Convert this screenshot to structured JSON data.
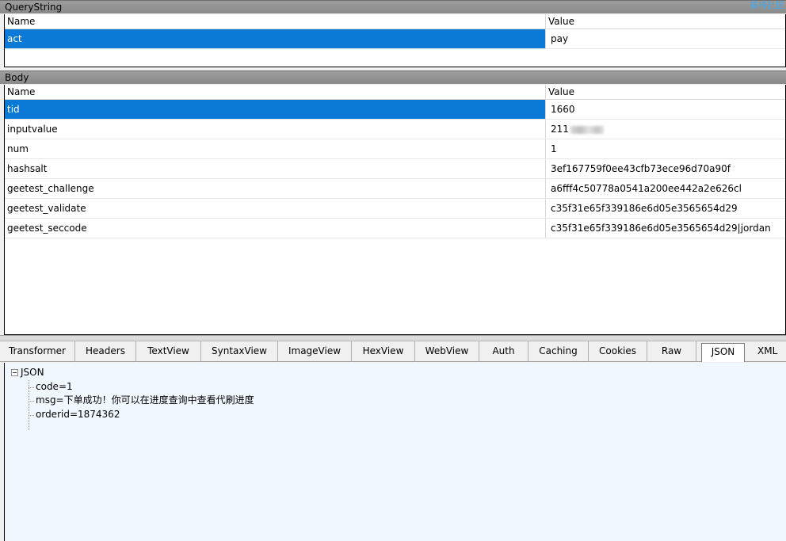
{
  "watermark": "搞棒社区",
  "querystring": {
    "section_title": "QueryString",
    "header": {
      "name": "Name",
      "value": "Value"
    },
    "rows": [
      {
        "name": "act",
        "value": "pay",
        "selected": true
      }
    ]
  },
  "body": {
    "section_title": "Body",
    "header": {
      "name": "Name",
      "value": "Value"
    },
    "rows": [
      {
        "name": "tid",
        "value": "1660",
        "selected": true
      },
      {
        "name": "inputvalue",
        "value": "211"
      },
      {
        "name": "num",
        "value": "1"
      },
      {
        "name": "hashsalt",
        "value": "3ef167759f0ee43cfb73ece96d70a90f"
      },
      {
        "name": "geetest_challenge",
        "value": "a6fff4c50778a0541a200ee442a2e626cl"
      },
      {
        "name": "geetest_validate",
        "value": "c35f31e65f339186e6d05e3565654d29"
      },
      {
        "name": "geetest_seccode",
        "value": "c35f31e65f339186e6d05e3565654d29|jordan"
      }
    ]
  },
  "tabs": [
    {
      "label": "Transformer"
    },
    {
      "label": "Headers"
    },
    {
      "label": "TextView"
    },
    {
      "label": "SyntaxView"
    },
    {
      "label": "ImageView"
    },
    {
      "label": "HexView"
    },
    {
      "label": "WebView"
    },
    {
      "label": "Auth"
    },
    {
      "label": "Caching"
    },
    {
      "label": "Cookies"
    },
    {
      "label": "Raw"
    },
    {
      "label": "JSON",
      "active": true
    },
    {
      "label": "XML"
    }
  ],
  "json_tree": {
    "root_label": "JSON",
    "children": [
      "code=1",
      "msg=下单成功！你可以在进度查询中查看代刷进度",
      "orderid=1874362"
    ]
  }
}
